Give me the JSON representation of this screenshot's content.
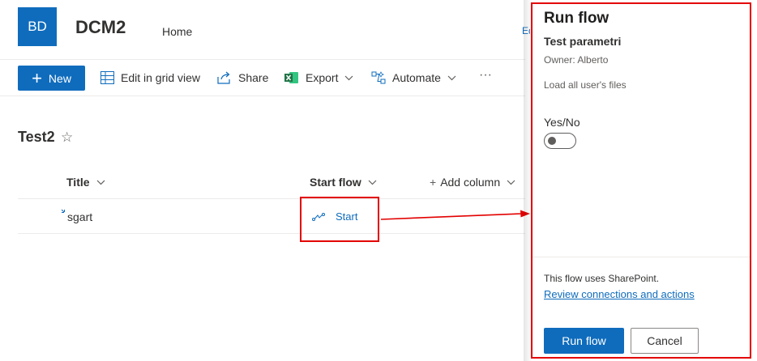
{
  "site": {
    "logo_initials": "BD",
    "title": "DCM2",
    "nav_home": "Home",
    "edit_hint": "Ed"
  },
  "command_bar": {
    "new_label": "New",
    "edit_grid_label": "Edit in grid view",
    "share_label": "Share",
    "export_label": "Export",
    "automate_label": "Automate",
    "more_label": "···"
  },
  "list": {
    "title": "Test2",
    "star": "☆",
    "columns": {
      "title": "Title",
      "start_flow": "Start flow",
      "add_column": "Add column"
    },
    "add_column_prefix": "+",
    "rows": [
      {
        "title": "sgart",
        "start_flow": "Start"
      }
    ]
  },
  "panel": {
    "title": "Run flow",
    "flow_name": "Test parametri",
    "owner": "Owner: Alberto",
    "description": "Load all user's files",
    "yes_no_label": "Yes/No",
    "toggle_on": false,
    "uses_text": "This flow uses SharePoint.",
    "review_link": "Review connections and actions",
    "run_button": "Run flow",
    "cancel_button": "Cancel"
  },
  "colors": {
    "accent": "#0f6cbd",
    "annotation_red": "#e30000",
    "excel_green": "#217346"
  },
  "icons": [
    "plus-icon",
    "grid-icon",
    "share-icon",
    "excel-icon",
    "automate-icon",
    "chevron-down-icon",
    "star-icon",
    "flow-icon",
    "new-item-icon"
  ]
}
